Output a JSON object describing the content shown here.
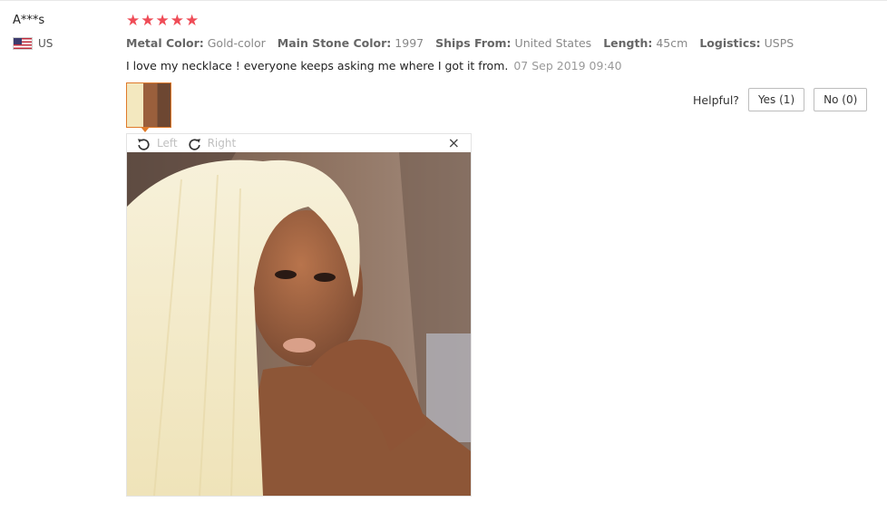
{
  "reviewer": {
    "name": "A***s",
    "country": "US"
  },
  "rating": {
    "stars": 5,
    "max": 5
  },
  "attributes": [
    {
      "label": "Metal Color:",
      "value": "Gold-color"
    },
    {
      "label": "Main Stone Color:",
      "value": "1997"
    },
    {
      "label": "Ships From:",
      "value": "United States"
    },
    {
      "label": "Length:",
      "value": "45cm"
    },
    {
      "label": "Logistics:",
      "value": "USPS"
    }
  ],
  "review": {
    "text": "I love my necklace ! everyone keeps asking me where I got it from.",
    "date": "07 Sep 2019 09:40"
  },
  "helpful": {
    "label": "Helpful?",
    "yes": "Yes (1)",
    "no": "No (0)"
  },
  "viewer": {
    "rotate_left": "Left",
    "rotate_right": "Right",
    "close": "×"
  },
  "icons": [
    "us-flag-icon",
    "star-icon",
    "rotate-left-icon",
    "rotate-right-icon",
    "close-icon"
  ],
  "colors": {
    "star": "#ef4c57",
    "thumb_border": "#e07a2a"
  }
}
